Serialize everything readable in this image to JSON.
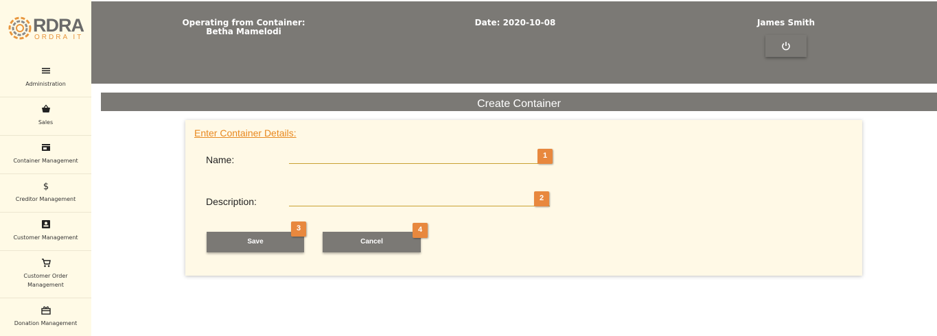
{
  "brand": {
    "name": "RDRA",
    "sub": "ORDRA IT"
  },
  "sidebar": {
    "items": [
      {
        "label": "Administration",
        "icon": "menu-icon"
      },
      {
        "label": "Sales",
        "icon": "basket-icon"
      },
      {
        "label": "Container Management",
        "icon": "store-icon"
      },
      {
        "label": "Creditor Management",
        "icon": "dollar-icon"
      },
      {
        "label": "Customer Management",
        "icon": "contact-card-icon"
      },
      {
        "label": "Customer Order Management",
        "icon": "cart-icon"
      },
      {
        "label": "Donation Management",
        "icon": "gift-icon"
      }
    ]
  },
  "header": {
    "container_label": "Operating from Container:",
    "container_name": "Betha Mamelodi",
    "date": "Date: 2020-10-08",
    "user": "James Smith",
    "power_icon": "power-icon"
  },
  "page": {
    "title": "Create Container"
  },
  "form": {
    "heading": "Enter Container Details:",
    "name_label": "Name:",
    "name_value": "",
    "description_label": "Description:",
    "description_value": "",
    "save_label": "Save",
    "cancel_label": "Cancel",
    "badges": [
      "1",
      "2",
      "3",
      "4"
    ]
  },
  "colors": {
    "accent": "#e8883e",
    "header_bg": "#7b7975",
    "sidebar_bg": "#fffae6",
    "card_bg": "#fff9e6"
  }
}
